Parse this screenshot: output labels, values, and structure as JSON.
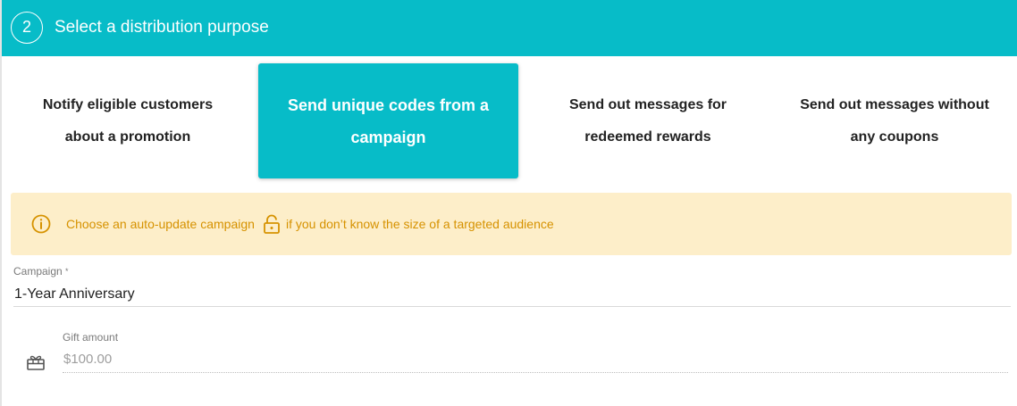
{
  "header": {
    "step_number": "2",
    "title": "Select a distribution purpose"
  },
  "purpose_options": [
    {
      "label": "Notify eligible customers about a promotion",
      "selected": false
    },
    {
      "label": "Send unique codes from a campaign",
      "selected": true
    },
    {
      "label": "Send out messages for redeemed rewards",
      "selected": false
    },
    {
      "label": "Send out messages without any coupons",
      "selected": false
    }
  ],
  "alert": {
    "text_before": "Choose an auto-update campaign",
    "text_after": "if you don’t know the size of a targeted audience",
    "icons": [
      "info-icon",
      "lock-icon"
    ]
  },
  "campaign_field": {
    "label": "Campaign",
    "required_mark": "*",
    "value": "1-Year Anniversary"
  },
  "gift_field": {
    "label": "Gift amount",
    "placeholder": "$100.00",
    "icon": "gift-icon"
  },
  "colors": {
    "accent": "#07bcc8",
    "alert_background": "#fdeec9",
    "alert_text": "#d69200"
  }
}
